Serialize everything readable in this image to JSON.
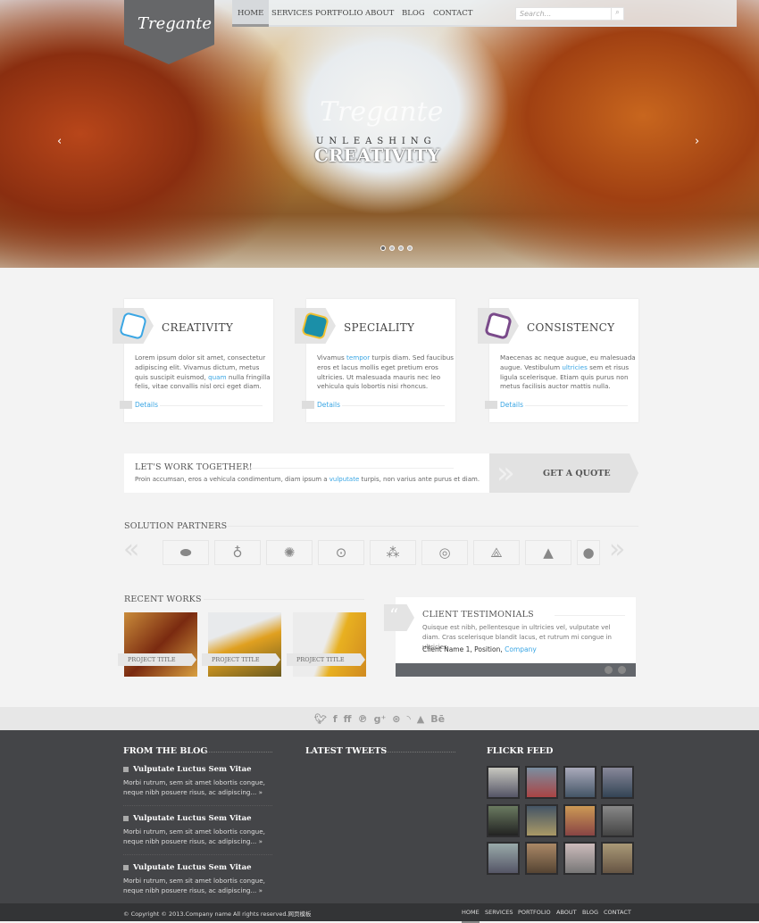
{
  "logo": "Tregante",
  "nav": [
    "HOME",
    "SERVICES",
    "PORTFOLIO",
    "ABOUT",
    "BLOG",
    "CONTACT"
  ],
  "search": {
    "placeholder": "Search..."
  },
  "hero": {
    "brand": "Tregante",
    "line1": "UNLEASHING",
    "line2": "CREATIVITY",
    "slides": 4,
    "active_slide": 1
  },
  "features": [
    {
      "title": "CREATIVITY",
      "pre": "Lorem ipsum dolor sit amet, consectetur adipiscing elit. Vivamus dictum, metus quis suscipit euismod, ",
      "link": "quam",
      "post": " nulla fringilla felis, vitae convallis nisl orci eget diam.",
      "details": "Details"
    },
    {
      "title": "SPECIALITY",
      "pre": "Vivamus ",
      "link": "tempor",
      "post": " turpis diam. Sed faucibus eros et lacus mollis eget pretium eros ultricies. Ut malesuada mauris nec leo vehicula quis lobortis nisi rhoncus.",
      "details": "Details"
    },
    {
      "title": "CONSISTENCY",
      "pre": "Maecenas ac neque augue, eu malesuada augue. Vestibulum ",
      "link": "ultricies",
      "post": " sem et risus ligula scelerisque. Etiam quis purus non metus facilisis auctor mattis nulla.",
      "details": "Details"
    }
  ],
  "cta": {
    "title": "LET'S WORK TOGETHER!",
    "pre": "Proin accumsan, eros a vehicula condimentum, diam ipsum a ",
    "link": "vulputate",
    "post": " turpis, non varius ante purus et diam.",
    "button": "GET A QUOTE"
  },
  "partners": {
    "title": "SOLUTION PARTNERS"
  },
  "recent": {
    "title": "RECENT WORKS",
    "items": [
      "PROJECT TITLE",
      "PROJECT TITLE",
      "PROJECT TITLE"
    ]
  },
  "testimonial": {
    "title": "CLIENT TESTIMONIALS",
    "text": "Quisque est nibh, pellentesque in ultricies vel, vulputate vel diam. Cras scelerisque blandit lacus, et rutrum mi congue in ultricies.",
    "client": "Client Name 1, Position, ",
    "company": "Company"
  },
  "social": [
    "twitter",
    "facebook",
    "friendfeed",
    "pinterest",
    "google-plus",
    "dribbble",
    "rss",
    "forrst",
    "behance"
  ],
  "footer": {
    "blog_title": "FROM THE BLOG",
    "tweets_title": "LATEST TWEETS",
    "flickr_title": "FLICKR FEED",
    "posts": [
      {
        "title": "Vulputate Luctus Sem Vitae",
        "text": "Morbi rutrum, sem sit amet lobortis congue, neque nibh posuere risus, ac adipiscing... »"
      },
      {
        "title": "Vulputate Luctus Sem Vitae",
        "text": "Morbi rutrum, sem sit amet lobortis congue, neque nibh posuere risus, ac adipiscing... »"
      },
      {
        "title": "Vulputate Luctus Sem Vitae",
        "text": "Morbi rutrum, sem sit amet lobortis congue, neque nibh posuere risus, ac adipiscing... »"
      }
    ],
    "copyright": "© Copyright © 2013.Company name All rights reserved.网页模板",
    "nav": [
      "HOME",
      "SERVICES",
      "PORTFOLIO",
      "ABOUT",
      "BLOG",
      "CONTACT"
    ]
  },
  "colors": {
    "link": "#3aa6e4",
    "footer": "#444548"
  }
}
